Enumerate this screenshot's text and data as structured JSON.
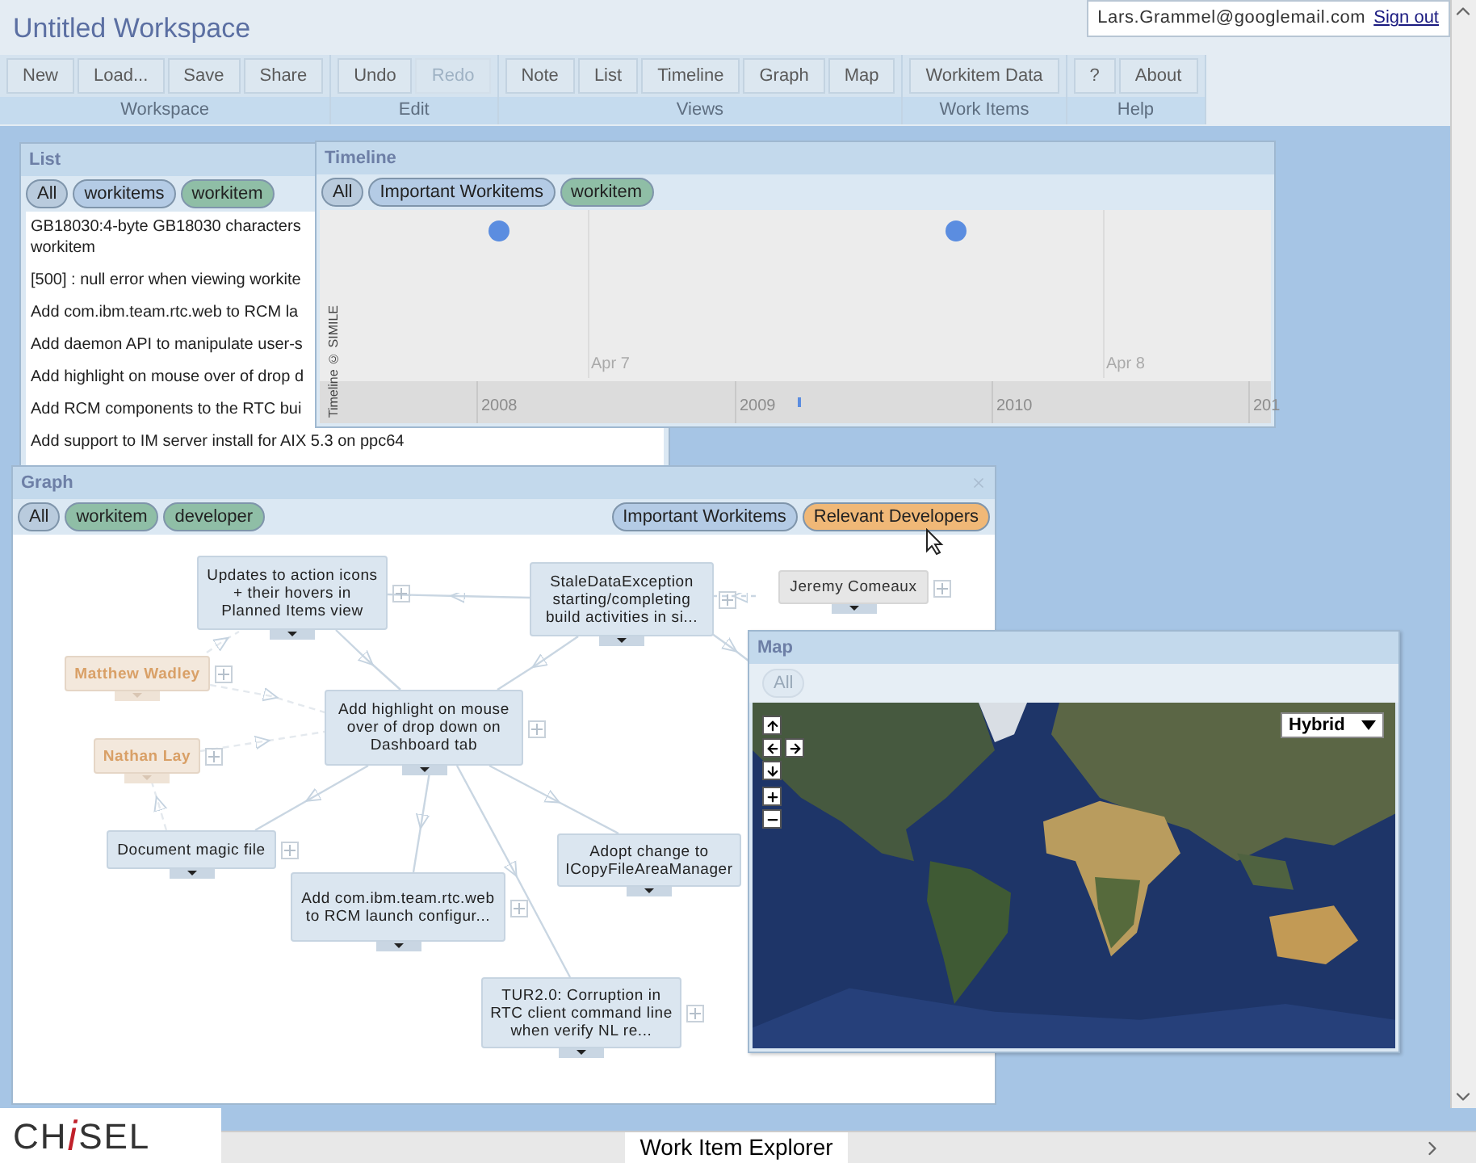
{
  "window": {
    "title": "Untitled Workspace"
  },
  "user": {
    "email": "Lars.Grammel@googlemail.com",
    "sign_out": "Sign out"
  },
  "toolbar": [
    {
      "group": "Workspace",
      "buttons": [
        {
          "label": "New",
          "disabled": false
        },
        {
          "label": "Load...",
          "disabled": false
        },
        {
          "label": "Save",
          "disabled": false
        },
        {
          "label": "Share",
          "disabled": false
        }
      ]
    },
    {
      "group": "Edit",
      "buttons": [
        {
          "label": "Undo",
          "disabled": false
        },
        {
          "label": "Redo",
          "disabled": true
        }
      ]
    },
    {
      "group": "Views",
      "buttons": [
        {
          "label": "Note",
          "disabled": false
        },
        {
          "label": "List",
          "disabled": false
        },
        {
          "label": "Timeline",
          "disabled": false
        },
        {
          "label": "Graph",
          "disabled": false
        },
        {
          "label": "Map",
          "disabled": false
        }
      ]
    },
    {
      "group": "Work Items",
      "buttons": [
        {
          "label": "Workitem Data",
          "disabled": false
        }
      ]
    },
    {
      "group": "Help",
      "buttons": [
        {
          "label": "?",
          "disabled": false
        },
        {
          "label": "About",
          "disabled": false
        }
      ]
    }
  ],
  "list_panel": {
    "title": "List",
    "filters": [
      {
        "label": "All",
        "color": "#b9cbdd"
      },
      {
        "label": "workitems",
        "color": "#b4cbe5"
      },
      {
        "label": "workitem",
        "color": "#8fbea6"
      }
    ],
    "items": [
      {
        "lines": [
          "GB18030:4-byte GB18030 characters",
          "workitem"
        ]
      },
      {
        "lines": [
          "[500] : null error when viewing workite"
        ]
      },
      {
        "lines": [
          "Add com.ibm.team.rtc.web to RCM la"
        ]
      },
      {
        "lines": [
          "Add daemon API to manipulate user-s"
        ]
      },
      {
        "lines": [
          "Add highlight on mouse over of drop d"
        ]
      },
      {
        "lines": [
          "Add RCM components to the RTC bui"
        ]
      },
      {
        "lines": [
          "Add support to IM server install for AIX 5.3 on ppc64"
        ]
      }
    ]
  },
  "timeline_panel": {
    "title": "Timeline",
    "filters": [
      {
        "label": "All",
        "color": "#b9cbdd"
      },
      {
        "label": "Important Workitems",
        "color": "#b4cbe5"
      },
      {
        "label": "workitem",
        "color": "#8fbea6"
      }
    ],
    "credit": "Timeline © SIMILE",
    "upper_labels": [
      "Apr 7",
      "Apr 8"
    ],
    "lower_labels": [
      "2008",
      "2009",
      "2010",
      "201"
    ]
  },
  "graph_panel": {
    "title": "Graph",
    "filters_left": [
      {
        "label": "All",
        "color": "#b9cbdd"
      },
      {
        "label": "workitem",
        "color": "#8fbea6"
      },
      {
        "label": "developer",
        "color": "#8fbea6"
      }
    ],
    "filters_right": [
      {
        "label": "Important Workitems",
        "color": "#b4cbe5"
      },
      {
        "label": "Relevant Developers",
        "color": "#f0b877"
      }
    ],
    "nodes": [
      {
        "label": "Updates to action icons + their hovers in Planned Items view",
        "kind": "workitem",
        "dimmed": false
      },
      {
        "label": "StaleDataException starting/completing build activities in si...",
        "kind": "workitem",
        "dimmed": false
      },
      {
        "label": "Jeremy Comeaux",
        "kind": "developer",
        "dimmed": false
      },
      {
        "label": "Matthew Wadley",
        "kind": "developer",
        "dimmed": true
      },
      {
        "label": "Add highlight on mouse over of drop down on Dashboard tab",
        "kind": "workitem",
        "dimmed": false
      },
      {
        "label": "Nathan Lay",
        "kind": "developer",
        "dimmed": true
      },
      {
        "label": "Document magic file",
        "kind": "workitem",
        "dimmed": false
      },
      {
        "label": "Adopt change to ICopyFileAreaManager",
        "kind": "workitem",
        "dimmed": false
      },
      {
        "label": "Add com.ibm.team.rtc.web to RCM launch configur...",
        "kind": "workitem",
        "dimmed": false
      },
      {
        "label": "TUR2.0: Corruption in RTC client command line when verify NL re...",
        "kind": "workitem",
        "dimmed": false
      }
    ]
  },
  "map_panel": {
    "title": "Map",
    "filters": [
      {
        "label": "All",
        "color": "#dfe9f2",
        "disabled": true
      }
    ],
    "map_type": "Hybrid"
  },
  "logo": {
    "before": "CH",
    "accent": "i",
    "after": "SEL"
  },
  "caption": "Work Item Explorer"
}
